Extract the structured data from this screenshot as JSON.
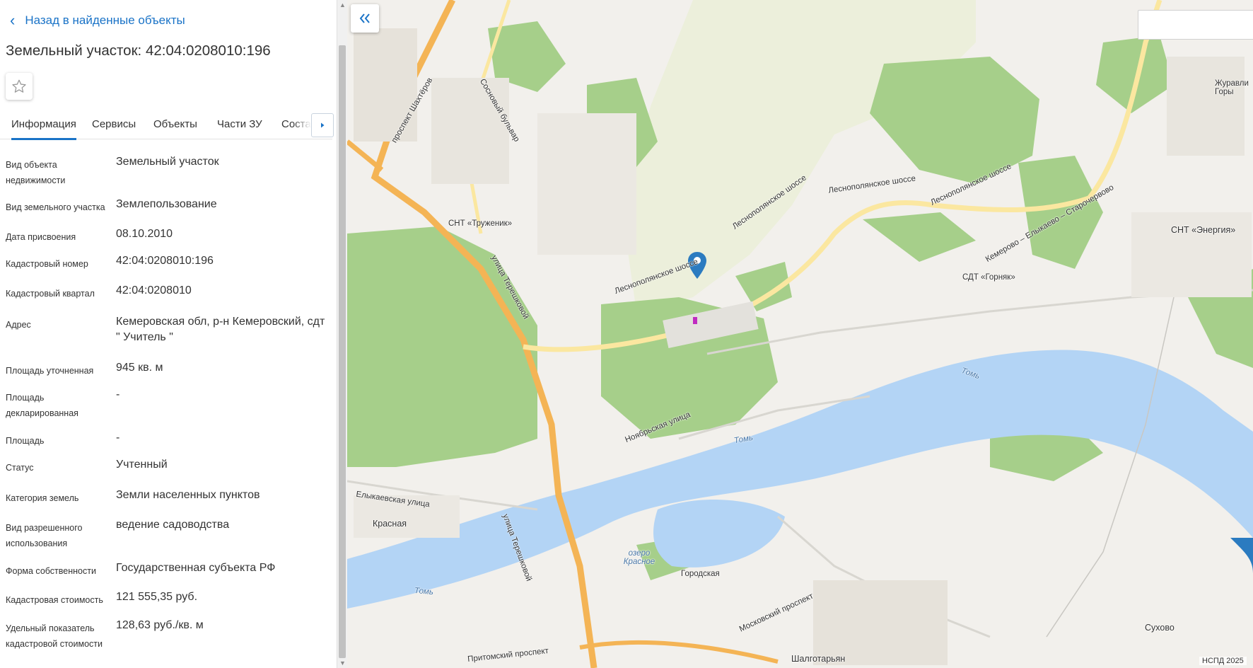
{
  "panel": {
    "back_label": "Назад в найденные объекты",
    "title": "Земельный участок: 42:04:0208010:196",
    "tabs": [
      "Информация",
      "Сервисы",
      "Объекты",
      "Части ЗУ",
      "Состав"
    ],
    "active_tab": 0,
    "attributes": [
      {
        "label": "Вид объекта недвижимости",
        "value": "Земельный участок"
      },
      {
        "label": "Вид земельного участка",
        "value": "Землепользование"
      },
      {
        "label": "Дата присвоения",
        "value": "08.10.2010"
      },
      {
        "label": "Кадастровый номер",
        "value": "42:04:0208010:196"
      },
      {
        "label": "Кадастровый квартал",
        "value": "42:04:0208010"
      },
      {
        "label": "Адрес",
        "value": "Кемеровская обл, р-н Кемеровский, сдт \" Учитель \""
      },
      {
        "label": "Площадь уточненная",
        "value": "945 кв. м"
      },
      {
        "label": "Площадь декларированная",
        "value": "-"
      },
      {
        "label": "Площадь",
        "value": "-"
      },
      {
        "label": "Статус",
        "value": "Учтенный"
      },
      {
        "label": "Категория земель",
        "value": "Земли населенных пунктов"
      },
      {
        "label": "Вид разрешенного использования",
        "value": "ведение садоводства"
      },
      {
        "label": "Форма собственности",
        "value": "Государственная субъекта РФ"
      },
      {
        "label": "Кадастровая стоимость",
        "value": "121 555,35 руб."
      },
      {
        "label": "Удельный показатель кадастровой стоимости",
        "value": "128,63 руб./кв. м"
      }
    ]
  },
  "map": {
    "copyright": "НСПД 2025",
    "labels": [
      "проспект Шахтёров",
      "Сосновый бульвар",
      "СНТ «Труженик»",
      "улица Терешковой",
      "Леснополянское шоссе",
      "Леснополянское шоссе",
      "Леснополянское шоссе",
      "Леснополянское шоссе",
      "СНТ «Энергия»",
      "Кемерово – Елыкаево – Старочервово",
      "СДТ «Горняк»",
      "Журавли Горы",
      "Томь",
      "Томь",
      "Томь",
      "Ноябрьская улица",
      "Елыкаевская улица",
      "Красная",
      "улица Терешковой",
      "озеро Красное",
      "Городская",
      "Московский проспект",
      "Шалготарьян",
      "Сухово",
      "Притомский проспект"
    ]
  },
  "colors": {
    "accent": "#1a73c7",
    "water": "#b3d4f5",
    "forest": "#a6cf8a",
    "major_road": "#f4b455",
    "secondary_road": "#fbe7a0",
    "marker": "#2b7bc0"
  },
  "icons": {
    "back": "chevron-left-icon",
    "favorite": "star-outline-icon",
    "tab_next": "caret-right-icon",
    "collapse": "double-chevron-left-icon",
    "marker": "map-pin-icon"
  }
}
